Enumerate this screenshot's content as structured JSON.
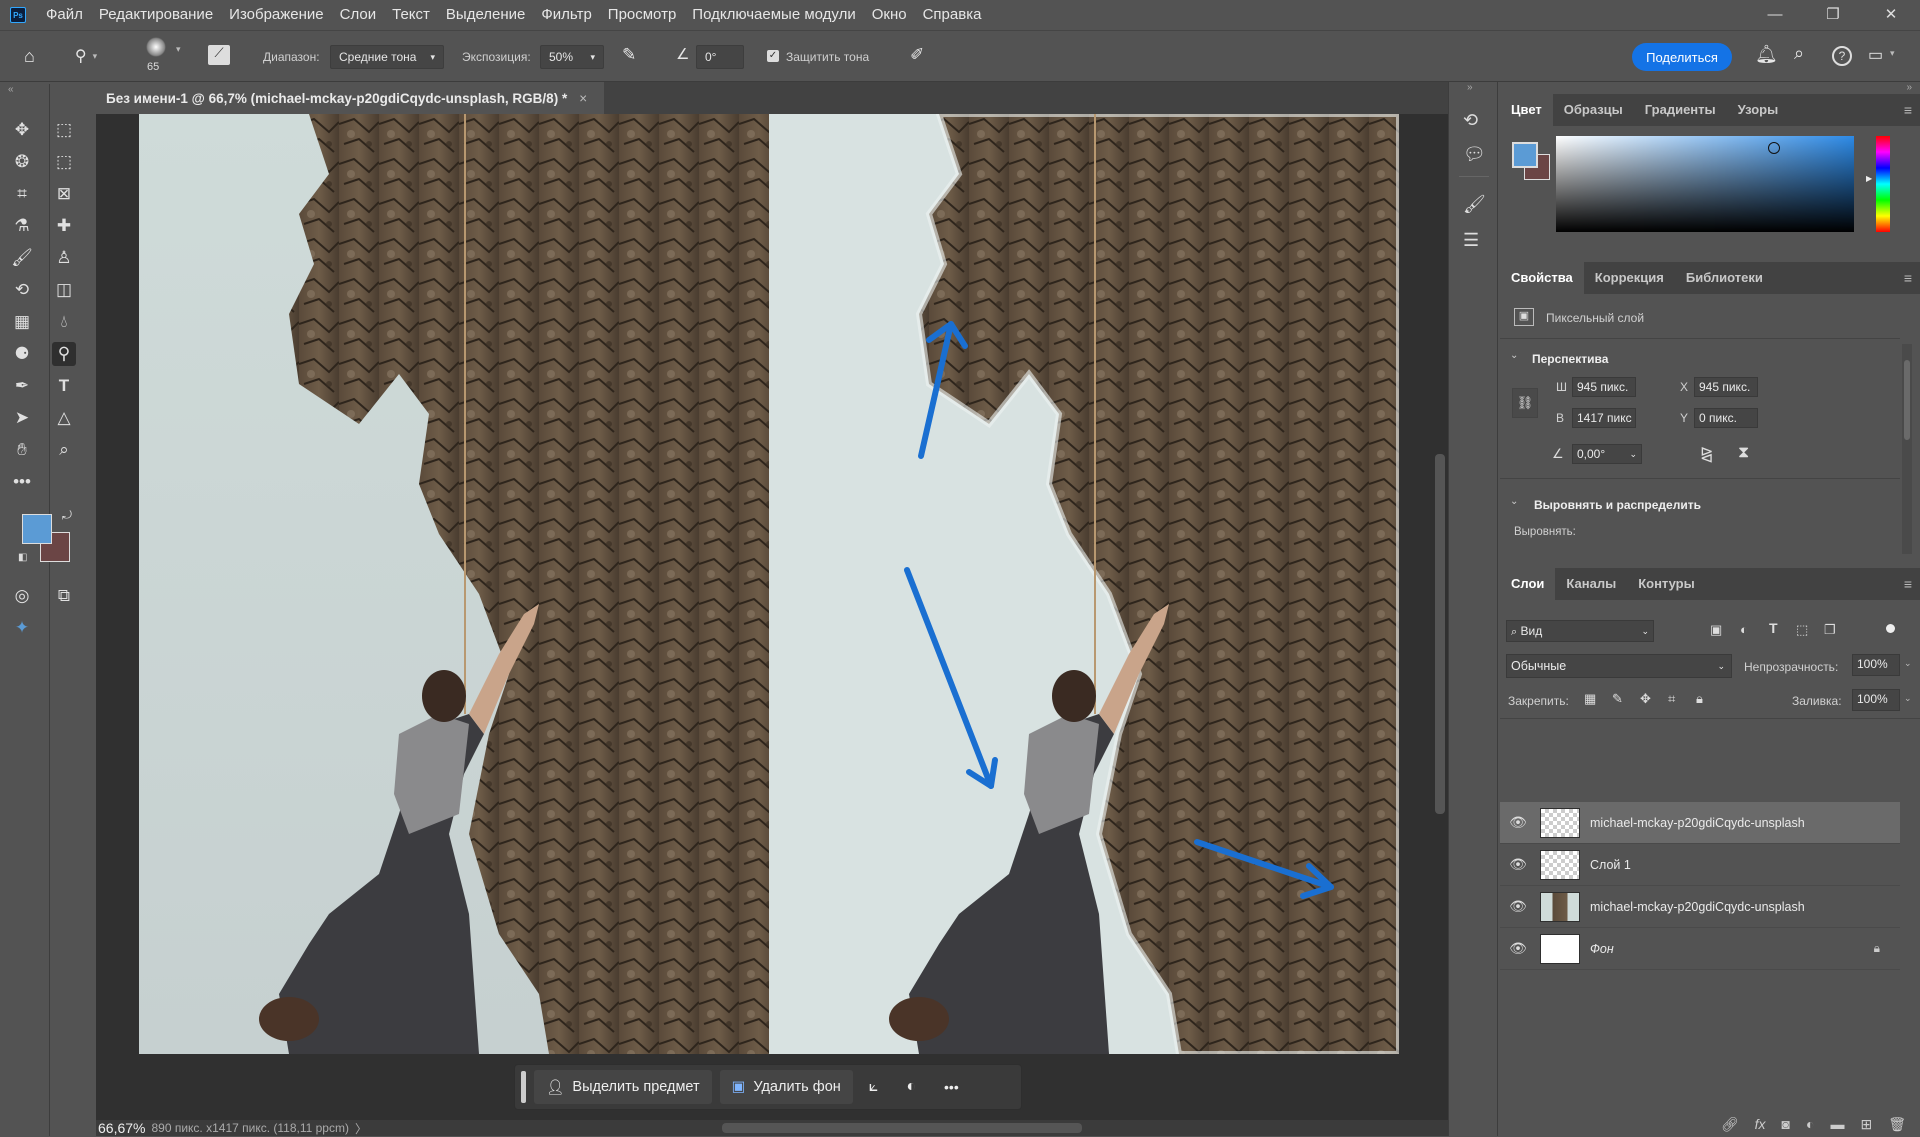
{
  "menubar": {
    "app_icon": "Ps",
    "items": [
      "Файл",
      "Редактирование",
      "Изображение",
      "Слои",
      "Текст",
      "Выделение",
      "Фильтр",
      "Просмотр",
      "Подключаемые модули",
      "Окно",
      "Справка"
    ],
    "window_controls": [
      "minimize-icon",
      "restore-icon",
      "close-icon"
    ]
  },
  "options": {
    "brush_size": "65",
    "range_label": "Диапазон:",
    "range_value": "Средние тона",
    "exposure_label": "Экспозиция:",
    "exposure_value": "50%",
    "angle_value": "0°",
    "protect_tones_label": "Защитить тона",
    "protect_tones_checked": true,
    "share_label": "Поделиться"
  },
  "document": {
    "tab_title": "Без имени-1 @ 66,7% (michael-mckay-p20gdiCqydc-unsplash, RGB/8) *",
    "close": "×"
  },
  "status": {
    "zoom": "66,67%",
    "info": "890 пикс. x1417 пикс. (118,11 ppcm)"
  },
  "contextbar": {
    "select_subject": "Выделить предмет",
    "remove_bg": "Удалить фон",
    "more": "•••"
  },
  "colors": {
    "foreground": "#5b9bd5",
    "background": "#6b4545",
    "accent": "#1473e6",
    "arrow": "#1a6fd1"
  },
  "color_panel": {
    "tabs": [
      "Цвет",
      "Образцы",
      "Градиенты",
      "Узоры"
    ]
  },
  "properties_panel": {
    "tabs": [
      "Свойства",
      "Коррекция",
      "Библиотеки"
    ],
    "kind": "Пиксельный слой",
    "section_transform": "Перспектива",
    "w_label": "Ш",
    "w_value": "945 пикс.",
    "h_label": "В",
    "h_value": "1417 пикс",
    "x_label": "X",
    "x_value": "945 пикс.",
    "y_label": "Y",
    "y_value": "0 пикс.",
    "angle_value": "0,00°",
    "section_align": "Выровнять и распределить",
    "align_label": "Выровнять:"
  },
  "layers_panel": {
    "tabs": [
      "Слои",
      "Каналы",
      "Контуры"
    ],
    "filter_label": "Вид",
    "blend_mode": "Обычные",
    "opacity_label": "Непрозрачность:",
    "opacity_value": "100%",
    "lock_label": "Закрепить:",
    "fill_label": "Заливка:",
    "fill_value": "100%",
    "layers": [
      {
        "name": "michael-mckay-p20gdiCqydc-unsplash"
      },
      {
        "name": "Слой 1"
      },
      {
        "name": "michael-mckay-p20gdiCqydc-unsplash"
      },
      {
        "name": "Фон"
      }
    ],
    "footer_icons": [
      "link-icon",
      "fx-icon",
      "mask-icon",
      "adjustment-icon",
      "folder-icon",
      "new-layer-icon",
      "trash-icon"
    ]
  }
}
